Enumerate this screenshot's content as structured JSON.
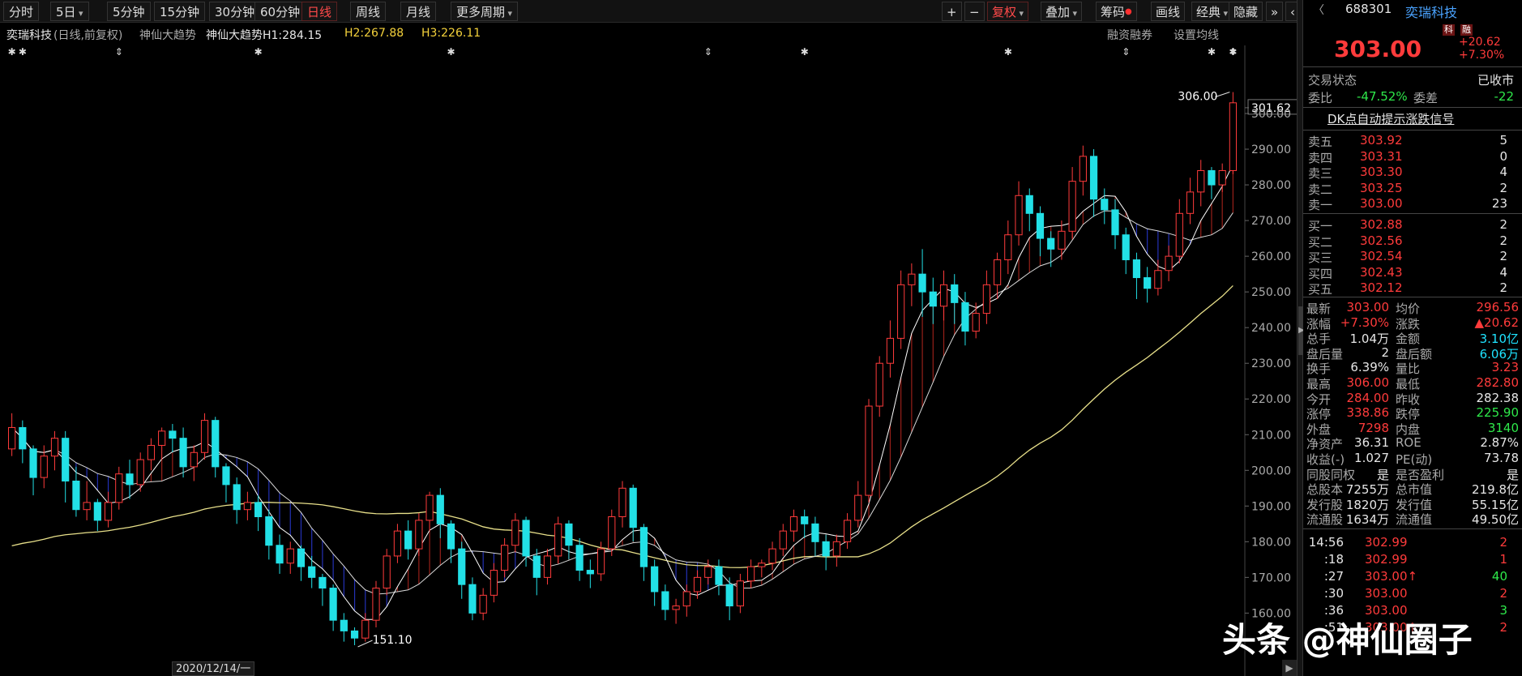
{
  "toolbar": {
    "periods": [
      "分时",
      "5日",
      "5分钟",
      "15分钟",
      "30分钟",
      "60分钟",
      "日线",
      "周线",
      "月线",
      "更多周期"
    ],
    "active_period": "日线",
    "right_buttons": [
      "+",
      "−",
      "复权",
      "叠加",
      "筹码",
      "画线",
      "经典",
      "隐藏",
      "»",
      "‹"
    ]
  },
  "infobar": {
    "stock_name": "奕瑞科技",
    "mode": "(日线,前复权)",
    "indicator_name": "神仙大趋势",
    "h1": "神仙大趋势H1:284.15",
    "h2": "H2:267.88",
    "h3": "H3:226.11",
    "margin_label": "融资融券",
    "ma_setting": "设置均线"
  },
  "chart_data": {
    "type": "candlestick",
    "ylim": [
      151,
      310
    ],
    "yticks": [
      "301.62",
      "300.00",
      "290.00",
      "280.00",
      "270.00",
      "260.00",
      "250.00",
      "240.00",
      "230.00",
      "220.00",
      "210.00",
      "200.00",
      "190.00",
      "180.00",
      "170.00",
      "160.00"
    ],
    "current_price": 301.62,
    "high_mark": "306.00",
    "low_mark": "151.10",
    "date_label": "2020/12/14/一",
    "candles": [
      [
        206,
        212,
        204,
        216
      ],
      [
        212,
        206,
        202,
        214
      ],
      [
        206,
        198,
        193,
        207
      ],
      [
        198,
        204,
        195,
        207
      ],
      [
        204,
        209,
        200,
        211
      ],
      [
        209,
        197,
        191,
        211
      ],
      [
        197,
        189,
        187,
        201
      ],
      [
        189,
        191,
        186,
        197
      ],
      [
        191,
        186,
        183,
        192
      ],
      [
        186,
        191,
        184,
        194
      ],
      [
        191,
        199,
        189,
        201
      ],
      [
        199,
        196,
        192,
        203
      ],
      [
        196,
        203,
        194,
        205
      ],
      [
        203,
        207,
        200,
        209
      ],
      [
        207,
        211,
        203,
        212
      ],
      [
        211,
        209,
        205,
        213
      ],
      [
        209,
        201,
        198,
        212
      ],
      [
        201,
        205,
        197,
        207
      ],
      [
        205,
        214,
        203,
        216
      ],
      [
        214,
        201,
        198,
        215
      ],
      [
        201,
        196,
        191,
        202
      ],
      [
        196,
        189,
        185,
        198
      ],
      [
        189,
        191,
        186,
        194
      ],
      [
        191,
        187,
        183,
        193
      ],
      [
        187,
        179,
        175,
        189
      ],
      [
        179,
        174,
        171,
        182
      ],
      [
        174,
        178,
        171,
        180
      ],
      [
        178,
        173,
        169,
        179
      ],
      [
        173,
        170,
        167,
        176
      ],
      [
        170,
        167,
        162,
        171
      ],
      [
        167,
        158,
        155,
        168
      ],
      [
        158,
        155,
        152,
        160
      ],
      [
        155,
        153,
        151,
        156
      ],
      [
        153,
        158,
        152,
        160
      ],
      [
        158,
        167,
        156,
        169
      ],
      [
        167,
        176,
        165,
        178
      ],
      [
        176,
        183,
        174,
        185
      ],
      [
        183,
        178,
        175,
        186
      ],
      [
        178,
        186,
        176,
        188
      ],
      [
        186,
        193,
        183,
        194
      ],
      [
        193,
        185,
        181,
        195
      ],
      [
        185,
        178,
        174,
        186
      ],
      [
        178,
        168,
        164,
        180
      ],
      [
        168,
        160,
        158,
        170
      ],
      [
        160,
        165,
        158,
        167
      ],
      [
        165,
        172,
        163,
        174
      ],
      [
        172,
        179,
        170,
        181
      ],
      [
        179,
        186,
        177,
        188
      ],
      [
        186,
        176,
        173,
        187
      ],
      [
        176,
        170,
        165,
        178
      ],
      [
        170,
        176,
        168,
        178
      ],
      [
        176,
        185,
        174,
        187
      ],
      [
        185,
        179,
        175,
        186
      ],
      [
        179,
        172,
        169,
        181
      ],
      [
        172,
        171,
        167,
        175
      ],
      [
        171,
        178,
        169,
        180
      ],
      [
        178,
        187,
        176,
        189
      ],
      [
        187,
        195,
        184,
        197
      ],
      [
        195,
        184,
        180,
        196
      ],
      [
        184,
        173,
        169,
        185
      ],
      [
        173,
        166,
        162,
        175
      ],
      [
        166,
        161,
        158,
        168
      ],
      [
        161,
        162,
        157,
        164
      ],
      [
        162,
        166,
        159,
        168
      ],
      [
        166,
        170,
        164,
        172
      ],
      [
        170,
        173,
        168,
        175
      ],
      [
        173,
        168,
        165,
        175
      ],
      [
        168,
        162,
        158,
        170
      ],
      [
        162,
        169,
        160,
        171
      ],
      [
        169,
        173,
        167,
        175
      ],
      [
        173,
        174,
        170,
        175
      ],
      [
        174,
        178,
        172,
        180
      ],
      [
        178,
        183,
        176,
        185
      ],
      [
        183,
        187,
        180,
        189
      ],
      [
        187,
        185,
        181,
        189
      ],
      [
        185,
        180,
        176,
        187
      ],
      [
        180,
        176,
        172,
        182
      ],
      [
        176,
        180,
        173,
        182
      ],
      [
        180,
        186,
        178,
        188
      ],
      [
        186,
        193,
        184,
        197
      ],
      [
        193,
        218,
        191,
        220
      ],
      [
        218,
        230,
        215,
        232
      ],
      [
        230,
        237,
        226,
        242
      ],
      [
        237,
        252,
        234,
        256
      ],
      [
        252,
        255,
        246,
        258
      ],
      [
        255,
        250,
        243,
        262
      ],
      [
        250,
        246,
        241,
        254
      ],
      [
        246,
        252,
        242,
        256
      ],
      [
        252,
        247,
        241,
        255
      ],
      [
        247,
        239,
        235,
        250
      ],
      [
        239,
        244,
        237,
        247
      ],
      [
        244,
        252,
        241,
        256
      ],
      [
        252,
        259,
        248,
        261
      ],
      [
        259,
        266,
        255,
        270
      ],
      [
        266,
        277,
        263,
        281
      ],
      [
        277,
        272,
        267,
        279
      ],
      [
        272,
        265,
        260,
        274
      ],
      [
        265,
        262,
        257,
        267
      ],
      [
        262,
        267,
        259,
        270
      ],
      [
        267,
        281,
        265,
        285
      ],
      [
        281,
        288,
        277,
        291
      ],
      [
        288,
        276,
        271,
        290
      ],
      [
        276,
        273,
        269,
        279
      ],
      [
        273,
        266,
        262,
        276
      ],
      [
        266,
        259,
        255,
        268
      ],
      [
        259,
        254,
        248,
        261
      ],
      [
        254,
        251,
        247,
        257
      ],
      [
        251,
        256,
        249,
        259
      ],
      [
        256,
        260,
        253,
        263
      ],
      [
        260,
        272,
        258,
        276
      ],
      [
        272,
        278,
        269,
        282
      ],
      [
        278,
        284,
        274,
        287
      ],
      [
        284,
        280,
        276,
        285
      ],
      [
        280,
        284,
        278,
        286
      ],
      [
        284,
        303,
        283,
        306
      ]
    ]
  },
  "panel": {
    "code": "688301",
    "name": "奕瑞科技",
    "board_tag": "科",
    "margin_tag": "融",
    "price": "303.00",
    "change": "+20.62",
    "change_pct": "+7.30%",
    "status_label": "交易状态",
    "status_value": "已收市",
    "weibi_label": "委比",
    "weibi_value": "-47.52%",
    "weicha_label": "委差",
    "weicha_value": "-22",
    "dk_title": "DK点自动提示涨跌信号",
    "asks": [
      {
        "label": "卖五",
        "price": "303.92",
        "vol": "5"
      },
      {
        "label": "卖四",
        "price": "303.31",
        "vol": "0"
      },
      {
        "label": "卖三",
        "price": "303.30",
        "vol": "4"
      },
      {
        "label": "卖二",
        "price": "303.25",
        "vol": "2"
      },
      {
        "label": "卖一",
        "price": "303.00",
        "vol": "23"
      }
    ],
    "bids": [
      {
        "label": "买一",
        "price": "302.88",
        "vol": "2"
      },
      {
        "label": "买二",
        "price": "302.56",
        "vol": "2"
      },
      {
        "label": "买三",
        "price": "302.54",
        "vol": "2"
      },
      {
        "label": "买四",
        "price": "302.43",
        "vol": "4"
      },
      {
        "label": "买五",
        "price": "302.12",
        "vol": "2"
      }
    ],
    "stats": [
      {
        "l1": "最新",
        "v1": "303.00",
        "c1": "red",
        "l2": "均价",
        "v2": "296.56",
        "c2": "red"
      },
      {
        "l1": "涨幅",
        "v1": "+7.30%",
        "c1": "red",
        "l2": "涨跌",
        "v2": "▲20.62",
        "c2": "red"
      },
      {
        "l1": "总手",
        "v1": "1.04万",
        "c1": "white",
        "l2": "金额",
        "v2": "3.10亿",
        "c2": "cyan"
      },
      {
        "l1": "盘后量",
        "v1": "2",
        "c1": "white",
        "l2": "盘后额",
        "v2": "6.06万",
        "c2": "cyan"
      },
      {
        "l1": "换手",
        "v1": "6.39%",
        "c1": "white",
        "l2": "量比",
        "v2": "3.23",
        "c2": "red"
      },
      {
        "l1": "最高",
        "v1": "306.00",
        "c1": "red",
        "l2": "最低",
        "v2": "282.80",
        "c2": "red"
      },
      {
        "l1": "今开",
        "v1": "284.00",
        "c1": "red",
        "l2": "昨收",
        "v2": "282.38",
        "c2": "white"
      },
      {
        "l1": "涨停",
        "v1": "338.86",
        "c1": "red",
        "l2": "跌停",
        "v2": "225.90",
        "c2": "green"
      },
      {
        "l1": "外盘",
        "v1": "7298",
        "c1": "red",
        "l2": "内盘",
        "v2": "3140",
        "c2": "green"
      },
      {
        "l1": "净资产",
        "v1": "36.31",
        "c1": "white",
        "l2": "ROE",
        "v2": "2.87%",
        "c2": "white"
      },
      {
        "l1": "收益(-)",
        "v1": "1.027",
        "c1": "white",
        "l2": "PE(动)",
        "v2": "73.78",
        "c2": "white"
      },
      {
        "l1": "同股同权",
        "v1": "是",
        "c1": "white",
        "l2": "是否盈利",
        "v2": "是",
        "c2": "white"
      },
      {
        "l1": "总股本",
        "v1": "7255万",
        "c1": "white",
        "l2": "总市值",
        "v2": "219.8亿",
        "c2": "white"
      },
      {
        "l1": "发行股",
        "v1": "1820万",
        "c1": "white",
        "l2": "发行值",
        "v2": "55.15亿",
        "c2": "white"
      },
      {
        "l1": "流通股",
        "v1": "1634万",
        "c1": "white",
        "l2": "流通值",
        "v2": "49.50亿",
        "c2": "white"
      }
    ],
    "ticks": [
      {
        "time": "14:56",
        "price": "302.99",
        "vol": "2",
        "arrow": ""
      },
      {
        "time": ":18",
        "price": "302.99",
        "vol": "1",
        "arrow": ""
      },
      {
        "time": ":27",
        "price": "303.00",
        "vol": "40",
        "arrow": "↑"
      },
      {
        "time": ":30",
        "price": "303.00",
        "vol": "2",
        "arrow": ""
      },
      {
        "time": ":36",
        "price": "303.00",
        "vol": "3",
        "arrow": ""
      },
      {
        "time": ":51",
        "price": "303.00",
        "vol": "2",
        "arrow": "↑"
      }
    ]
  },
  "watermark": "头条 @神仙圈子"
}
